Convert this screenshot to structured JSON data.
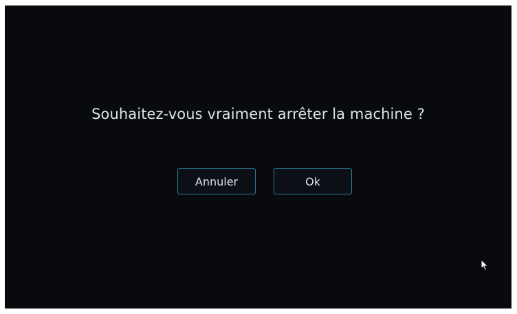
{
  "dialog": {
    "message": "Souhaitez-vous vraiment arrêter la machine ?",
    "cancel_label": "Annuler",
    "ok_label": "Ok"
  },
  "colors": {
    "background": "#080a0e",
    "text": "#dde3e8",
    "button_border": "#2e7f9a"
  },
  "icons": {
    "cursor": "mouse-pointer-icon"
  }
}
